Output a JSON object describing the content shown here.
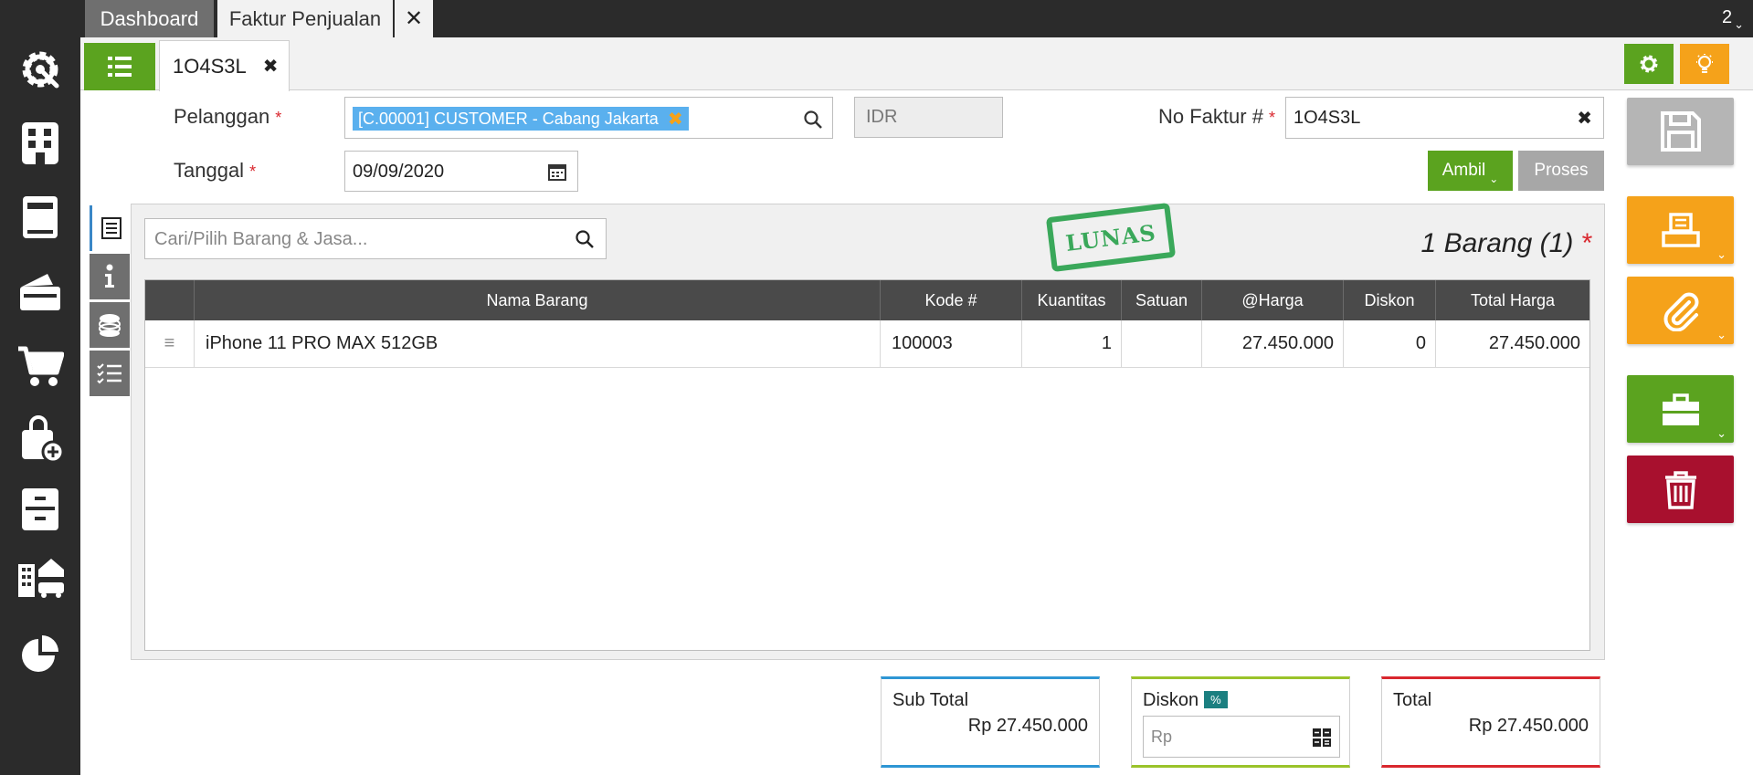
{
  "top_tabs": [
    {
      "label": "Dashboard"
    },
    {
      "label": "Faktur Penjualan"
    }
  ],
  "top_counter": "2",
  "doc_tab": {
    "label": "1O4S3L"
  },
  "form": {
    "customer_label": "Pelanggan",
    "customer_chip": "[C.00001] CUSTOMER - Cabang Jakarta",
    "currency_placeholder": "IDR",
    "invoice_no_label": "No Faktur #",
    "invoice_no_value": "1O4S3L",
    "date_label": "Tanggal",
    "date_value": "09/09/2020",
    "required_mark": "*",
    "ambil_label": "Ambil",
    "proses_label": "Proses"
  },
  "items_panel": {
    "search_placeholder": "Cari/Pilih Barang & Jasa...",
    "stamp": "LUNAS",
    "count": "1 Barang (1)",
    "columns": [
      "Nama Barang",
      "Kode #",
      "Kuantitas",
      "Satuan",
      "@Harga",
      "Diskon",
      "Total Harga"
    ],
    "rows": [
      {
        "name": "iPhone 11 PRO MAX 512GB",
        "code": "100003",
        "qty": "1",
        "unit": "",
        "price": "27.450.000",
        "discount": "0",
        "total": "27.450.000"
      }
    ]
  },
  "totals": {
    "subtotal_label": "Sub Total",
    "subtotal_value": "Rp 27.450.000",
    "discount_label": "Diskon",
    "discount_pct_badge": "%",
    "discount_placeholder": "Rp",
    "total_label": "Total",
    "total_value": "Rp 27.450.000"
  },
  "colors": {
    "green": "#5ba31f",
    "orange": "#f5a21a",
    "red": "#a8102e",
    "gray_button": "#a7a7a7",
    "sidebar": "#2b2b2b"
  },
  "icons": [
    "settings-icon",
    "building-icon",
    "book-icon",
    "wallet-icon",
    "cart-icon",
    "bag-add-icon",
    "cabinet-icon",
    "building-car-icon",
    "pie-chart-icon"
  ]
}
